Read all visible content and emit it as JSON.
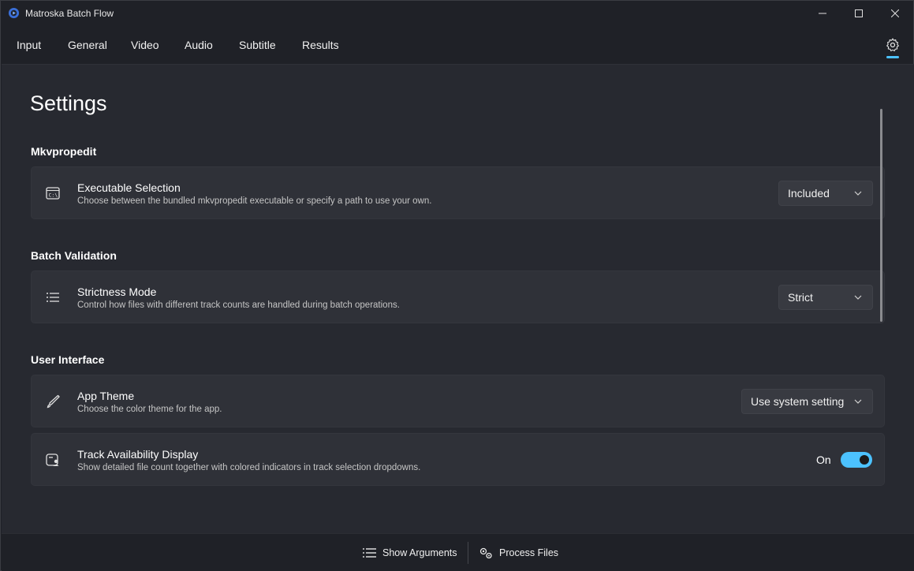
{
  "window": {
    "title": "Matroska Batch Flow"
  },
  "nav": {
    "tabs": [
      {
        "label": "Input"
      },
      {
        "label": "General"
      },
      {
        "label": "Video"
      },
      {
        "label": "Audio"
      },
      {
        "label": "Subtitle"
      },
      {
        "label": "Results"
      }
    ],
    "settings_icon": "gear-icon",
    "accent": "#4cc2ff"
  },
  "page": {
    "title": "Settings"
  },
  "sections": [
    {
      "title": "Mkvpropedit",
      "cards": [
        {
          "icon": "console-icon",
          "title": "Executable Selection",
          "description": "Choose between the bundled mkvpropedit executable or specify a path to use your own.",
          "control": {
            "type": "dropdown",
            "value": "Included"
          }
        }
      ]
    },
    {
      "title": "Batch Validation",
      "cards": [
        {
          "icon": "list-icon",
          "title": "Strictness Mode",
          "description": "Control how files with different track counts are handled during batch operations.",
          "control": {
            "type": "dropdown",
            "value": "Strict"
          }
        }
      ]
    },
    {
      "title": "User Interface",
      "cards": [
        {
          "icon": "brush-icon",
          "title": "App Theme",
          "description": "Choose the color theme for the app.",
          "control": {
            "type": "dropdown",
            "value": "Use system setting"
          }
        },
        {
          "icon": "track-display-icon",
          "title": "Track Availability Display",
          "description": "Show detailed file count together with colored indicators in track selection dropdowns.",
          "control": {
            "type": "toggle",
            "label": "On",
            "checked": true
          }
        }
      ]
    }
  ],
  "footer": {
    "show_arguments": {
      "label": "Show Arguments",
      "icon": "list-icon"
    },
    "process_files": {
      "label": "Process Files",
      "icon": "gears-icon"
    }
  }
}
